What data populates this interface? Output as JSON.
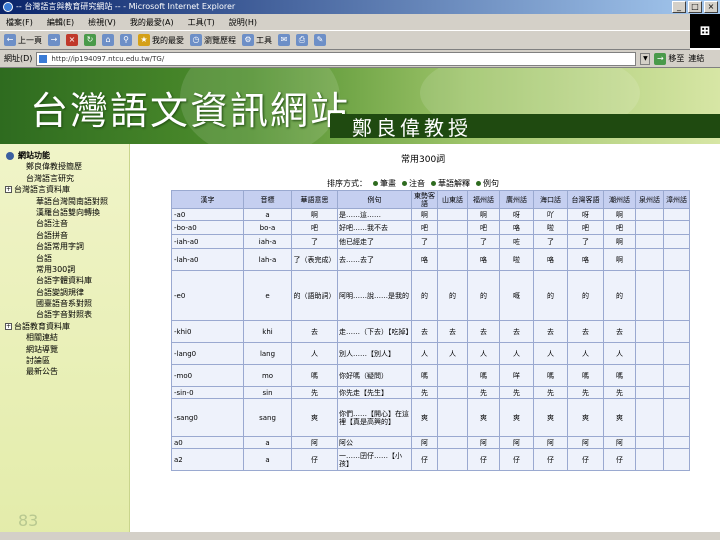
{
  "window": {
    "title": "-- 台灣語言與教育研究網站 -- - Microsoft Internet Explorer",
    "controls": [
      "_",
      "□",
      "×"
    ]
  },
  "menu": [
    "檔案(F)",
    "編輯(E)",
    "檢視(V)",
    "我的最愛(A)",
    "工具(T)",
    "說明(H)"
  ],
  "toolbar": {
    "back": "上一頁",
    "favorites": "我的最愛",
    "history": "瀏覽歷程",
    "tools": "工具"
  },
  "address": {
    "label": "網址(D)",
    "url": "http://ip194097.ntcu.edu.tw/TG/",
    "go": "移至",
    "links": "連結"
  },
  "banner": {
    "site_title": "台灣語文資訊網站",
    "professor": "鄭良偉教授"
  },
  "sidebar": {
    "items": [
      {
        "label": "網站功能",
        "level": "root"
      },
      {
        "label": "鄭良偉教授簡歷",
        "level": "l1"
      },
      {
        "label": "台灣語言研究",
        "level": "l1"
      },
      {
        "label": "台灣語言資料庫",
        "level": "l0"
      },
      {
        "label": "華語台灣閩南語對照",
        "level": "l2"
      },
      {
        "label": "漢羅台語雙向轉換",
        "level": "l2"
      },
      {
        "label": "台語注音",
        "level": "l2"
      },
      {
        "label": "台語拼音",
        "level": "l2"
      },
      {
        "label": "台語常用字詞",
        "level": "l2"
      },
      {
        "label": "台語",
        "level": "l2"
      },
      {
        "label": "常用300詞",
        "level": "l2"
      },
      {
        "label": "台語字體資料庫",
        "level": "l2"
      },
      {
        "label": "台語變調規律",
        "level": "l2"
      },
      {
        "label": "國臺語音系對照",
        "level": "l2"
      },
      {
        "label": "台語字音對照表",
        "level": "l2"
      },
      {
        "label": "台語教育資料庫",
        "level": "l0"
      },
      {
        "label": "相關連結",
        "level": "l1"
      },
      {
        "label": "網站導覽",
        "level": "l1"
      },
      {
        "label": "討論區",
        "level": "l1"
      },
      {
        "label": "最新公告",
        "level": "l1"
      }
    ],
    "page_number": "83"
  },
  "content": {
    "heading": "常用300詞",
    "options_label": "排序方式：",
    "options": [
      "筆畫",
      "注音",
      "華語解釋",
      "例句"
    ],
    "table": {
      "headers": [
        "漢字",
        "音標",
        "華語意思",
        "例句",
        "東勢客語",
        "山東話",
        "福州話",
        "廣州話",
        "海口話",
        "台灣客語",
        "潮州話",
        "泉州話",
        "漳州話"
      ],
      "rows": [
        [
          "-a0",
          "a",
          "啊",
          "是……這……",
          "啊",
          "",
          "啊",
          "呀",
          "吖",
          "呀",
          "啊",
          "",
          ""
        ],
        [
          "-bo-a0",
          "bo-a",
          "吧",
          "好吧……我不去",
          "吧",
          "",
          "吧",
          "咯",
          "啦",
          "吧",
          "吧",
          "",
          ""
        ],
        [
          "-iah-a0",
          "iah-a",
          "了",
          "他已經走了",
          "了",
          "",
          "了",
          "咗",
          "了",
          "了",
          "啊",
          "",
          ""
        ],
        [
          "-lah-a0",
          "lah-a",
          "了（表完成）",
          "去……去了",
          "咯",
          "",
          "咯",
          "啦",
          "咯",
          "咯",
          "啊",
          "",
          ""
        ],
        [
          "-e0",
          "e",
          "的（語助詞）",
          "阿明……說……是我的",
          "的",
          "的",
          "的",
          "嘅",
          "的",
          "的",
          "的",
          "",
          ""
        ],
        [
          "-khi0",
          "khi",
          "去",
          "走……（下去）【吃掉】",
          "去",
          "去",
          "去",
          "去",
          "去",
          "去",
          "去",
          "",
          ""
        ],
        [
          "-lang0",
          "lang",
          "人",
          "別人……【別人】",
          "人",
          "人",
          "人",
          "人",
          "人",
          "人",
          "人",
          "",
          ""
        ],
        [
          "-mo0",
          "mo",
          "嗎",
          "你好嗎（疑問）",
          "嗎",
          "",
          "嗎",
          "咩",
          "嗎",
          "嗎",
          "嗎",
          "",
          ""
        ],
        [
          "-sin-0",
          "sin",
          "先",
          "你先走【先生】",
          "先",
          "",
          "先",
          "先",
          "先",
          "先",
          "先",
          "",
          ""
        ],
        [
          "-sang0",
          "sang",
          "爽",
          "你們……【開心】在這裡【真是高興的】",
          "爽",
          "",
          "爽",
          "爽",
          "爽",
          "爽",
          "爽",
          "",
          ""
        ],
        [
          "a0",
          "a",
          "阿",
          "阿公",
          "阿",
          "",
          "阿",
          "阿",
          "阿",
          "阿",
          "阿",
          "",
          ""
        ],
        [
          "a2",
          "a",
          "仔",
          "一……囝仔……【小孩】",
          "仔",
          "",
          "仔",
          "仔",
          "仔",
          "仔",
          "仔",
          "",
          ""
        ]
      ]
    }
  }
}
